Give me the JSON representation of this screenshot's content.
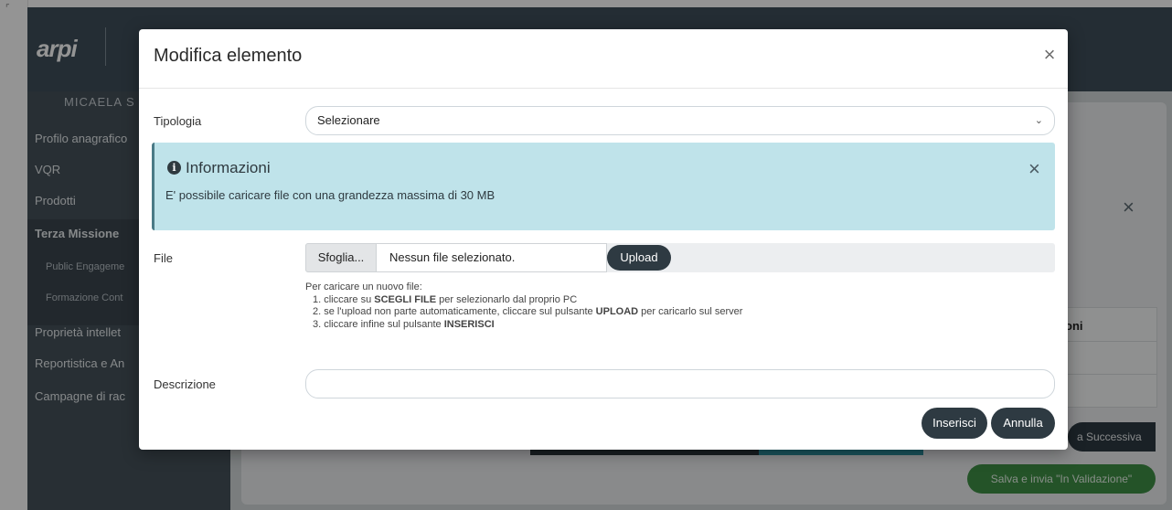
{
  "background": {
    "logo": "arpi",
    "user_name": "MICAELA S",
    "sidebar_items": [
      {
        "label": "Profilo anagrafico",
        "bold": false
      },
      {
        "label": "VQR",
        "bold": false
      },
      {
        "label": "Prodotti",
        "bold": false
      },
      {
        "label": "Terza Missione",
        "bold": true
      },
      {
        "label": "Proprietà intellet",
        "bold": false
      },
      {
        "label": "Reportistica e An",
        "bold": false
      },
      {
        "label": "Campagne di rac",
        "bold": false
      }
    ],
    "sidebar_subitems": [
      "Public Engageme",
      "Formazione Cont"
    ],
    "table_fragment_text": "oni",
    "next_button": "a Successiva",
    "validate_button": "Salva e invia \"In Validazione\""
  },
  "modal": {
    "title": "Modifica elemento",
    "tipologia_label": "Tipologia",
    "tipologia_value": "Selezionare",
    "alert": {
      "title": "Informazioni",
      "text": "E' possibile caricare file con una grandezza massima di 30 MB"
    },
    "file_label": "File",
    "browse_label": "Sfoglia...",
    "file_status": "Nessun file selezionato.",
    "upload_label": "Upload",
    "help": {
      "intro": "Per caricare un nuovo file:",
      "step1_pre": "1. cliccare su ",
      "step1_bold": "SCEGLI FILE",
      "step1_post": " per selezionarlo dal proprio PC",
      "step2_pre": "2. se l'upload non parte automaticamente, cliccare sul pulsante ",
      "step2_bold": "UPLOAD",
      "step2_post": " per caricarlo sul server",
      "step3_pre": "3. cliccare infine sul pulsante ",
      "step3_bold": "INSERISCI",
      "step3_post": ""
    },
    "descrizione_label": "Descrizione",
    "descrizione_value": "",
    "insert_label": "Inserisci",
    "cancel_label": "Annulla"
  }
}
